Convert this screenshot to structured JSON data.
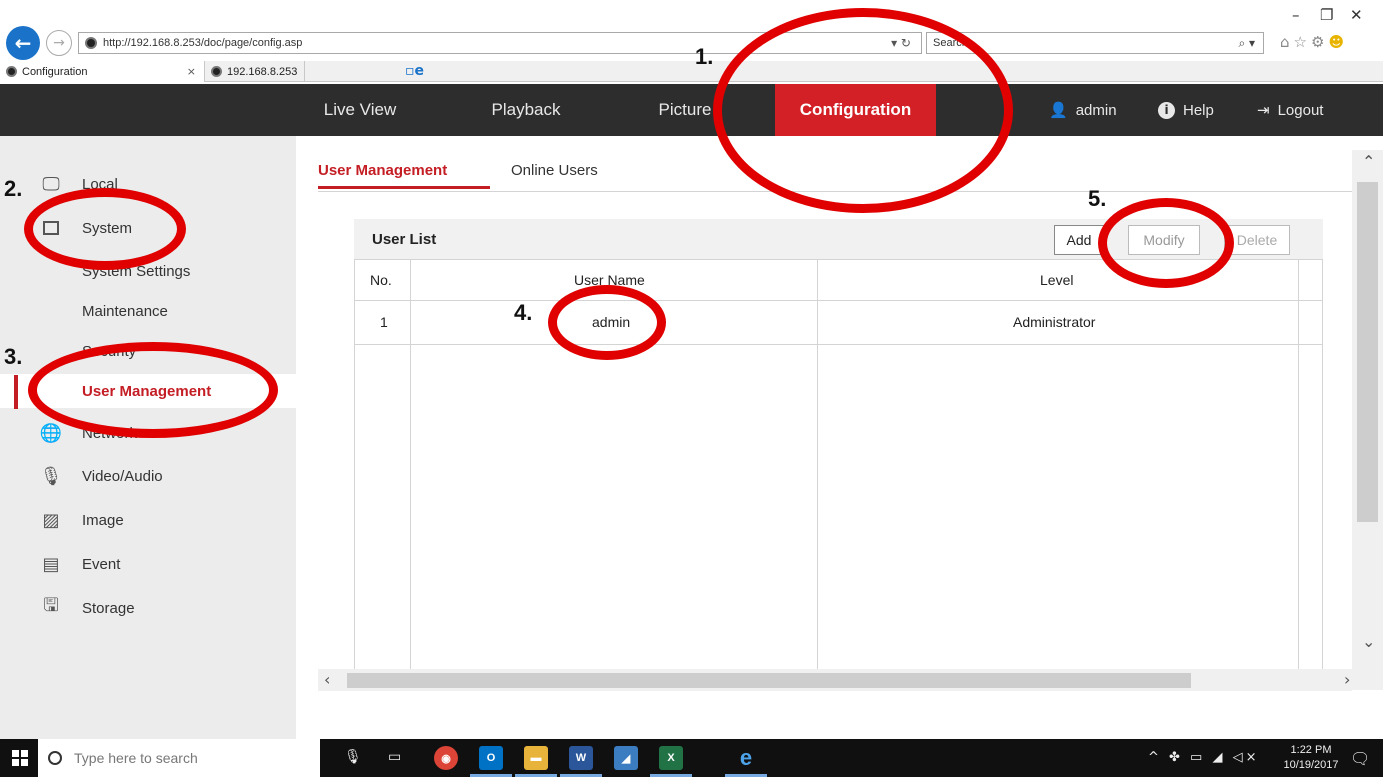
{
  "browser": {
    "url": "http://192.168.8.253/doc/page/config.asp",
    "search_placeholder": "Search...",
    "tabs": [
      {
        "label": "Configuration"
      },
      {
        "label": "192.168.8.253"
      }
    ]
  },
  "topnav": {
    "items": [
      "Live View",
      "Playback",
      "Picture",
      "Configuration"
    ],
    "user": "admin",
    "help": "Help",
    "logout": "Logout"
  },
  "sidebar": {
    "items": [
      {
        "label": "Local"
      },
      {
        "label": "System"
      },
      {
        "label": "System Settings"
      },
      {
        "label": "Maintenance"
      },
      {
        "label": "Security"
      },
      {
        "label": "User Management"
      },
      {
        "label": "Network"
      },
      {
        "label": "Video/Audio"
      },
      {
        "label": "Image"
      },
      {
        "label": "Event"
      },
      {
        "label": "Storage"
      }
    ]
  },
  "subtabs": [
    "User Management",
    "Online Users"
  ],
  "user_list": {
    "title": "User List",
    "buttons": {
      "add": "Add",
      "modify": "Modify",
      "delete": "Delete"
    },
    "columns": [
      "No.",
      "User Name",
      "Level"
    ],
    "rows": [
      {
        "no": "1",
        "name": "admin",
        "level": "Administrator"
      }
    ]
  },
  "annotations": [
    "1.",
    "2.",
    "3.",
    "4.",
    "5."
  ],
  "taskbar": {
    "search_placeholder": "Type here to search",
    "time": "1:22 PM",
    "date": "10/19/2017"
  },
  "colors": {
    "accent_red": "#d31f26",
    "nav_bg": "#2d2d2d",
    "annotation_red": "#e00000"
  }
}
